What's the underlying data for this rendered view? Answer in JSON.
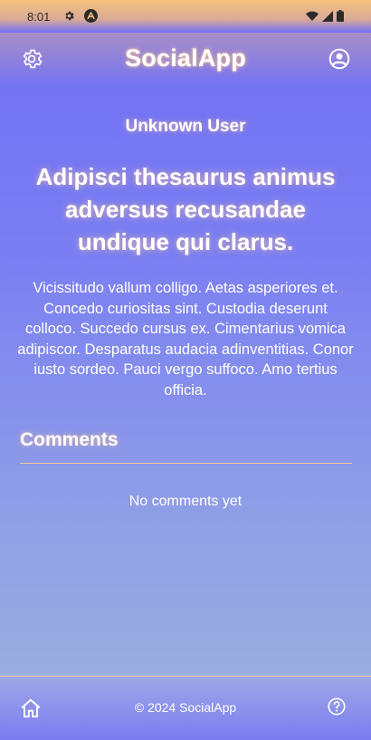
{
  "status_bar": {
    "time": "8:01",
    "icons": [
      "gear-icon",
      "a-icon",
      "wifi-icon",
      "signal-icon",
      "battery-icon"
    ]
  },
  "header": {
    "title": "SocialApp",
    "left_icon": "settings-icon",
    "right_icon": "account-icon"
  },
  "post": {
    "author": "Unknown User",
    "title": "Adipisci thesaurus animus adversus recusandae undique qui clarus.",
    "body": "Vicissitudo vallum colligo. Aetas asperiores et. Concedo curiositas sint. Custodia deserunt colloco. Succedo cursus ex. Cimentarius vomica adipiscor. Desparatus audacia adinventitias. Conor iusto sordeo. Pauci vergo suffoco. Amo tertius officia."
  },
  "comments": {
    "heading": "Comments",
    "empty_text": "No comments yet"
  },
  "footer": {
    "copyright": "© 2024 SocialApp",
    "left_icon": "home-icon",
    "right_icon": "help-icon"
  },
  "colors": {
    "accent_glow": "#f2c9a0",
    "gradient_top": "#6f6df5",
    "gradient_bottom": "#9fb3dd"
  }
}
